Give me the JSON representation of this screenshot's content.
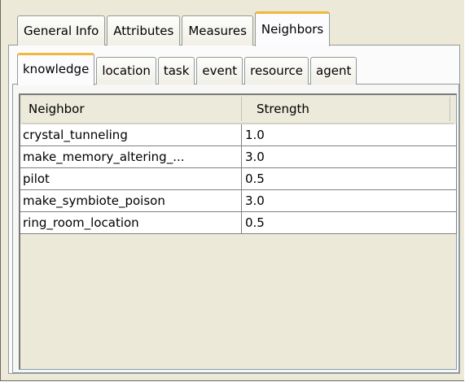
{
  "outer_tabs": [
    {
      "label": "General Info",
      "active": false
    },
    {
      "label": "Attributes",
      "active": false
    },
    {
      "label": "Measures",
      "active": false
    },
    {
      "label": "Neighbors",
      "active": true
    }
  ],
  "inner_tabs": [
    {
      "label": "knowledge",
      "active": true
    },
    {
      "label": "location",
      "active": false
    },
    {
      "label": "task",
      "active": false
    },
    {
      "label": "event",
      "active": false
    },
    {
      "label": "resource",
      "active": false
    },
    {
      "label": "agent",
      "active": false
    }
  ],
  "table": {
    "columns": [
      "Neighbor",
      "Strength"
    ],
    "rows": [
      [
        "crystal_tunneling",
        "1.0"
      ],
      [
        "make_memory_altering_...",
        "3.0"
      ],
      [
        "pilot",
        "0.5"
      ],
      [
        "make_symbiote_poison",
        "3.0"
      ],
      [
        "ring_room_location",
        "0.5"
      ]
    ]
  }
}
